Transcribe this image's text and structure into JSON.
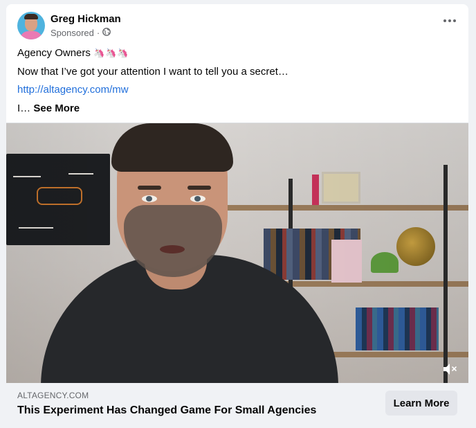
{
  "post": {
    "author": "Greg Hickman",
    "sponsored_label": "Sponsored",
    "separator": "·",
    "globe_icon": "globe-icon",
    "body": {
      "line1": "Agency Owners",
      "unicorns": "🦄🦄🦄",
      "line2": "Now that I’ve got your attention I want to tell you a secret…",
      "link": "http://altagency.com/mw",
      "line4_prefix": "I… ",
      "see_more": "See More"
    }
  },
  "video": {
    "mute_icon": "speaker-muted-icon"
  },
  "ad_footer": {
    "domain": "ALTAGENCY.COM",
    "headline": "This Experiment Has Changed Game For Small Agencies",
    "cta": "Learn More"
  },
  "colors": {
    "link": "#216fdb",
    "muted_text": "#65676b",
    "footer_bg": "#f0f2f5",
    "button_bg": "#e4e6eb"
  }
}
